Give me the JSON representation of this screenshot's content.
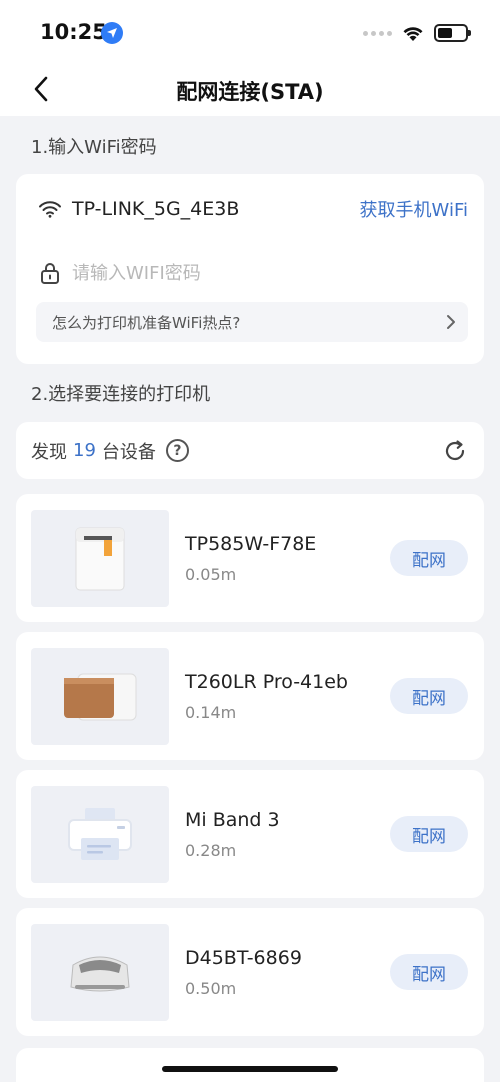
{
  "status": {
    "time": "10:25"
  },
  "nav": {
    "title": "配网连接(STA)"
  },
  "section1": {
    "title": "1.输入WiFi密码"
  },
  "wifi": {
    "ssid": "TP-LINK_5G_4E3B",
    "get_phone_wifi": "获取手机WiFi",
    "password_placeholder": "请输入WIFI密码",
    "help_text": "怎么为打印机准备WiFi热点?"
  },
  "section2": {
    "title": "2.选择要连接的打印机"
  },
  "found": {
    "prefix": "发现",
    "count": "19",
    "suffix": "台设备"
  },
  "devices": [
    {
      "name": "TP585W-F78E",
      "distance": "0.05m",
      "pair_label": "配网",
      "image": "white-printer-icon"
    },
    {
      "name": "T260LR Pro-41eb",
      "distance": "0.14m",
      "pair_label": "配网",
      "image": "brown-printer-icon"
    },
    {
      "name": "Mi Band 3",
      "distance": "0.28m",
      "pair_label": "配网",
      "image": "generic-printer-icon"
    },
    {
      "name": "D45BT-6869",
      "distance": "0.50m",
      "pair_label": "配网",
      "image": "label-printer-icon"
    }
  ],
  "colors": {
    "accent": "#3d72c8",
    "background": "#f2f3f6",
    "pair_button_bg": "#e8eef9"
  }
}
